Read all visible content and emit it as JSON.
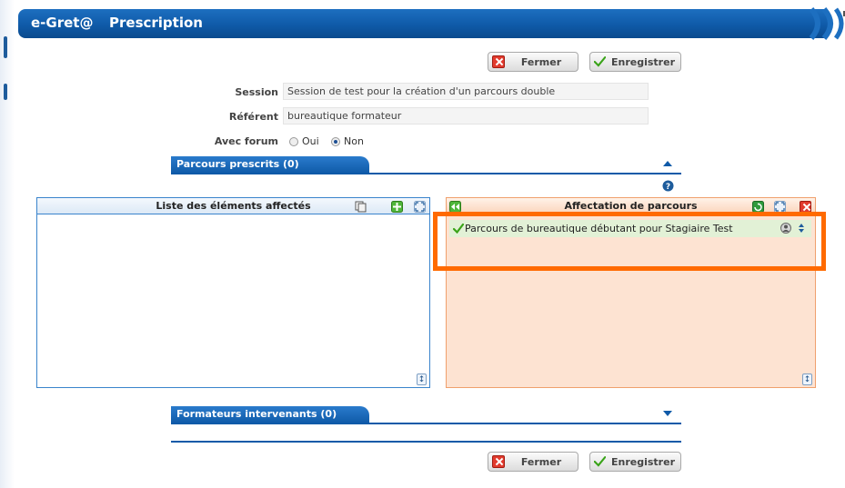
{
  "app": {
    "brand": "e-Gret@",
    "page_title": "Prescription"
  },
  "actions": {
    "close_label": "Fermer",
    "save_label": "Enregistrer"
  },
  "form": {
    "session_label": "Session",
    "session_value": "Session de test pour la création d'un parcours double",
    "referent_label": "Référent",
    "referent_value": "bureautique formateur",
    "forum_label": "Avec forum",
    "forum_options": [
      "Oui",
      "Non"
    ],
    "forum_selected": "Non"
  },
  "sections": {
    "prescribed": "Parcours prescrits (0)",
    "trainers": "Formateurs intervenants (0)"
  },
  "left_panel": {
    "title": "Liste des éléments affectés"
  },
  "right_panel": {
    "title": "Affectation de parcours",
    "items": [
      {
        "label": "Parcours de bureautique débutant pour Stagiaire Test"
      }
    ]
  },
  "colors": {
    "header_blue": "#0f5aa8",
    "highlight_orange": "#ff6a00",
    "right_panel_bg": "#fde3d2",
    "item_bg": "#e2f1d6"
  }
}
